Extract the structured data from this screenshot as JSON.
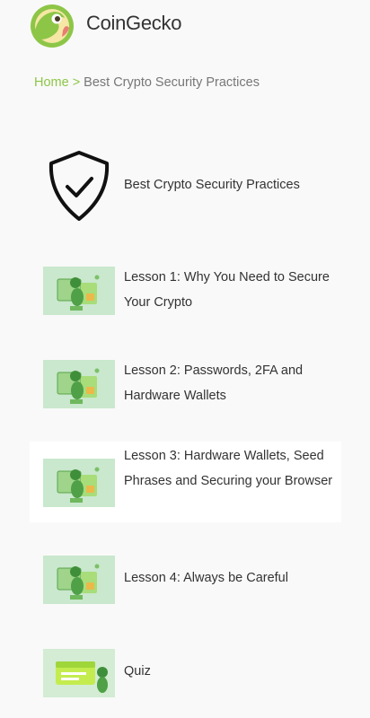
{
  "brand": {
    "name": "CoinGecko"
  },
  "breadcrumb": {
    "home": "Home",
    "separator": ">",
    "current": "Best Crypto Security Practices"
  },
  "course": {
    "title": "Best Crypto Security Practices",
    "lessons": [
      {
        "label": "Lesson 1: Why You Need to Secure Your Crypto"
      },
      {
        "label": "Lesson 2: Passwords, 2FA and Hardware Wallets"
      },
      {
        "label": "Lesson 3: Hardware Wallets, Seed Phrases and Securing your Browser"
      },
      {
        "label": "Lesson 4: Always be Careful"
      }
    ],
    "quiz": {
      "label": "Quiz"
    }
  },
  "colors": {
    "accent": "#8dc647",
    "thumb_bg": "#c9e8cd",
    "page_bg": "#f9f9f9"
  }
}
